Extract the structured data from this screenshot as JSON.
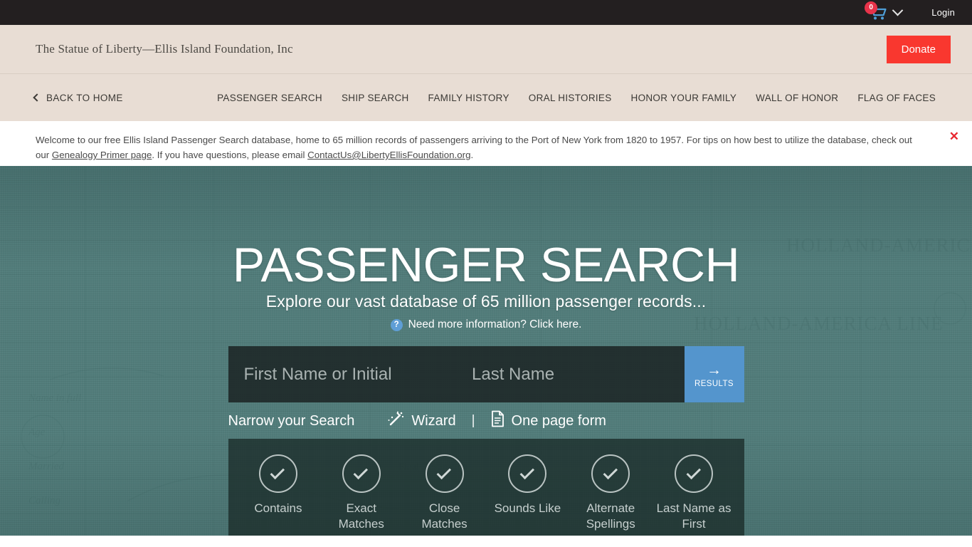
{
  "utility": {
    "cart_count": "0",
    "cart_icon": "shopping-cart-icon",
    "chevron_icon": "chevron-down-icon",
    "login_label": "Login"
  },
  "brand": {
    "title": "The Statue of Liberty—Ellis Island Foundation, Inc",
    "donate_label": "Donate",
    "donate_color": "#f9372f"
  },
  "nav": {
    "back_label": "BACK TO HOME",
    "back_icon": "chevron-left-icon",
    "links": [
      {
        "label": "PASSENGER SEARCH"
      },
      {
        "label": "SHIP SEARCH"
      },
      {
        "label": "FAMILY HISTORY"
      },
      {
        "label": "ORAL HISTORIES"
      },
      {
        "label": "HONOR YOUR FAMILY"
      },
      {
        "label": "WALL OF HONOR"
      },
      {
        "label": "FLAG OF FACES"
      }
    ]
  },
  "notice": {
    "part1": "Welcome to our free Ellis Island Passenger Search database, home to 65 million records of passengers arriving to the Port of New York from 1820 to 1957. For tips on how best to utilize the database, check out our ",
    "link1": "Genealogy Primer page",
    "part2": ". If you have questions, please email ",
    "link2": "ContactUs@LibertyEllisFoundation.org",
    "part3": ".",
    "close_label": "✕",
    "close_color": "#e8282f"
  },
  "hero": {
    "title": "PASSENGER SEARCH",
    "subtitle": "Explore our vast database of 65 million passenger records...",
    "help_icon": "question-mark-icon",
    "help_text": "Need more information? Click here.",
    "background_color": "#527d7b",
    "watermark_text_1": "HOLLAND-AMERICA LINE",
    "watermark_text_2": "HOLLAND-AMERICA LINE"
  },
  "search": {
    "first_name_value": "",
    "first_name_placeholder": "First Name or Initial",
    "last_name_value": "",
    "last_name_placeholder": "Last Name",
    "submit_label": "RESULTS",
    "submit_icon": "arrow-right-icon",
    "submit_color": "#5495cd"
  },
  "narrow": {
    "title": "Narrow your Search",
    "wizard_label": "Wizard",
    "wizard_icon": "magic-wand-icon",
    "divider": "|",
    "one_page_label": "One page form",
    "one_page_icon": "document-icon"
  },
  "filters": [
    {
      "label": "Contains",
      "checked": true
    },
    {
      "label": "Exact Matches",
      "checked": true
    },
    {
      "label": "Close Matches",
      "checked": true
    },
    {
      "label": "Sounds Like",
      "checked": true
    },
    {
      "label": "Alternate Spellings",
      "checked": true
    },
    {
      "label": "Last Name as First",
      "checked": true
    }
  ]
}
